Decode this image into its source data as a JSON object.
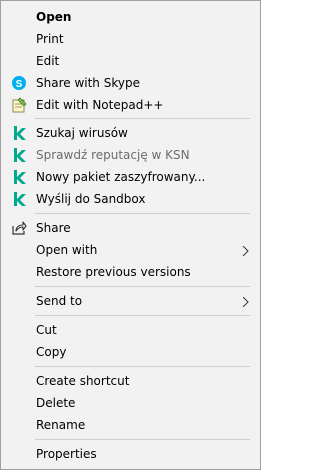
{
  "menu": {
    "open": "Open",
    "print": "Print",
    "edit": "Edit",
    "share_skype": "Share with Skype",
    "edit_notepad": "Edit with Notepad++",
    "scan_virus": "Szukaj wirusów",
    "check_reputation": "Sprawdź reputację w KSN",
    "new_encrypted": "Nowy pakiet zaszyfrowany...",
    "send_sandbox": "Wyślij do Sandbox",
    "share": "Share",
    "open_with": "Open with",
    "restore_versions": "Restore previous versions",
    "send_to": "Send to",
    "cut": "Cut",
    "copy": "Copy",
    "create_shortcut": "Create shortcut",
    "delete": "Delete",
    "rename": "Rename",
    "properties": "Properties"
  },
  "colors": {
    "menu_bg": "#f2f2f2",
    "kaspersky_green": "#00a88e",
    "skype_blue": "#00aff0",
    "disabled_text": "#6d6d6d"
  },
  "icons": {
    "skype": "skype-icon",
    "notepad": "notepad-plus-plus-icon",
    "kaspersky": "kaspersky-k-icon",
    "share": "share-icon",
    "chevron": "chevron-right-icon"
  }
}
